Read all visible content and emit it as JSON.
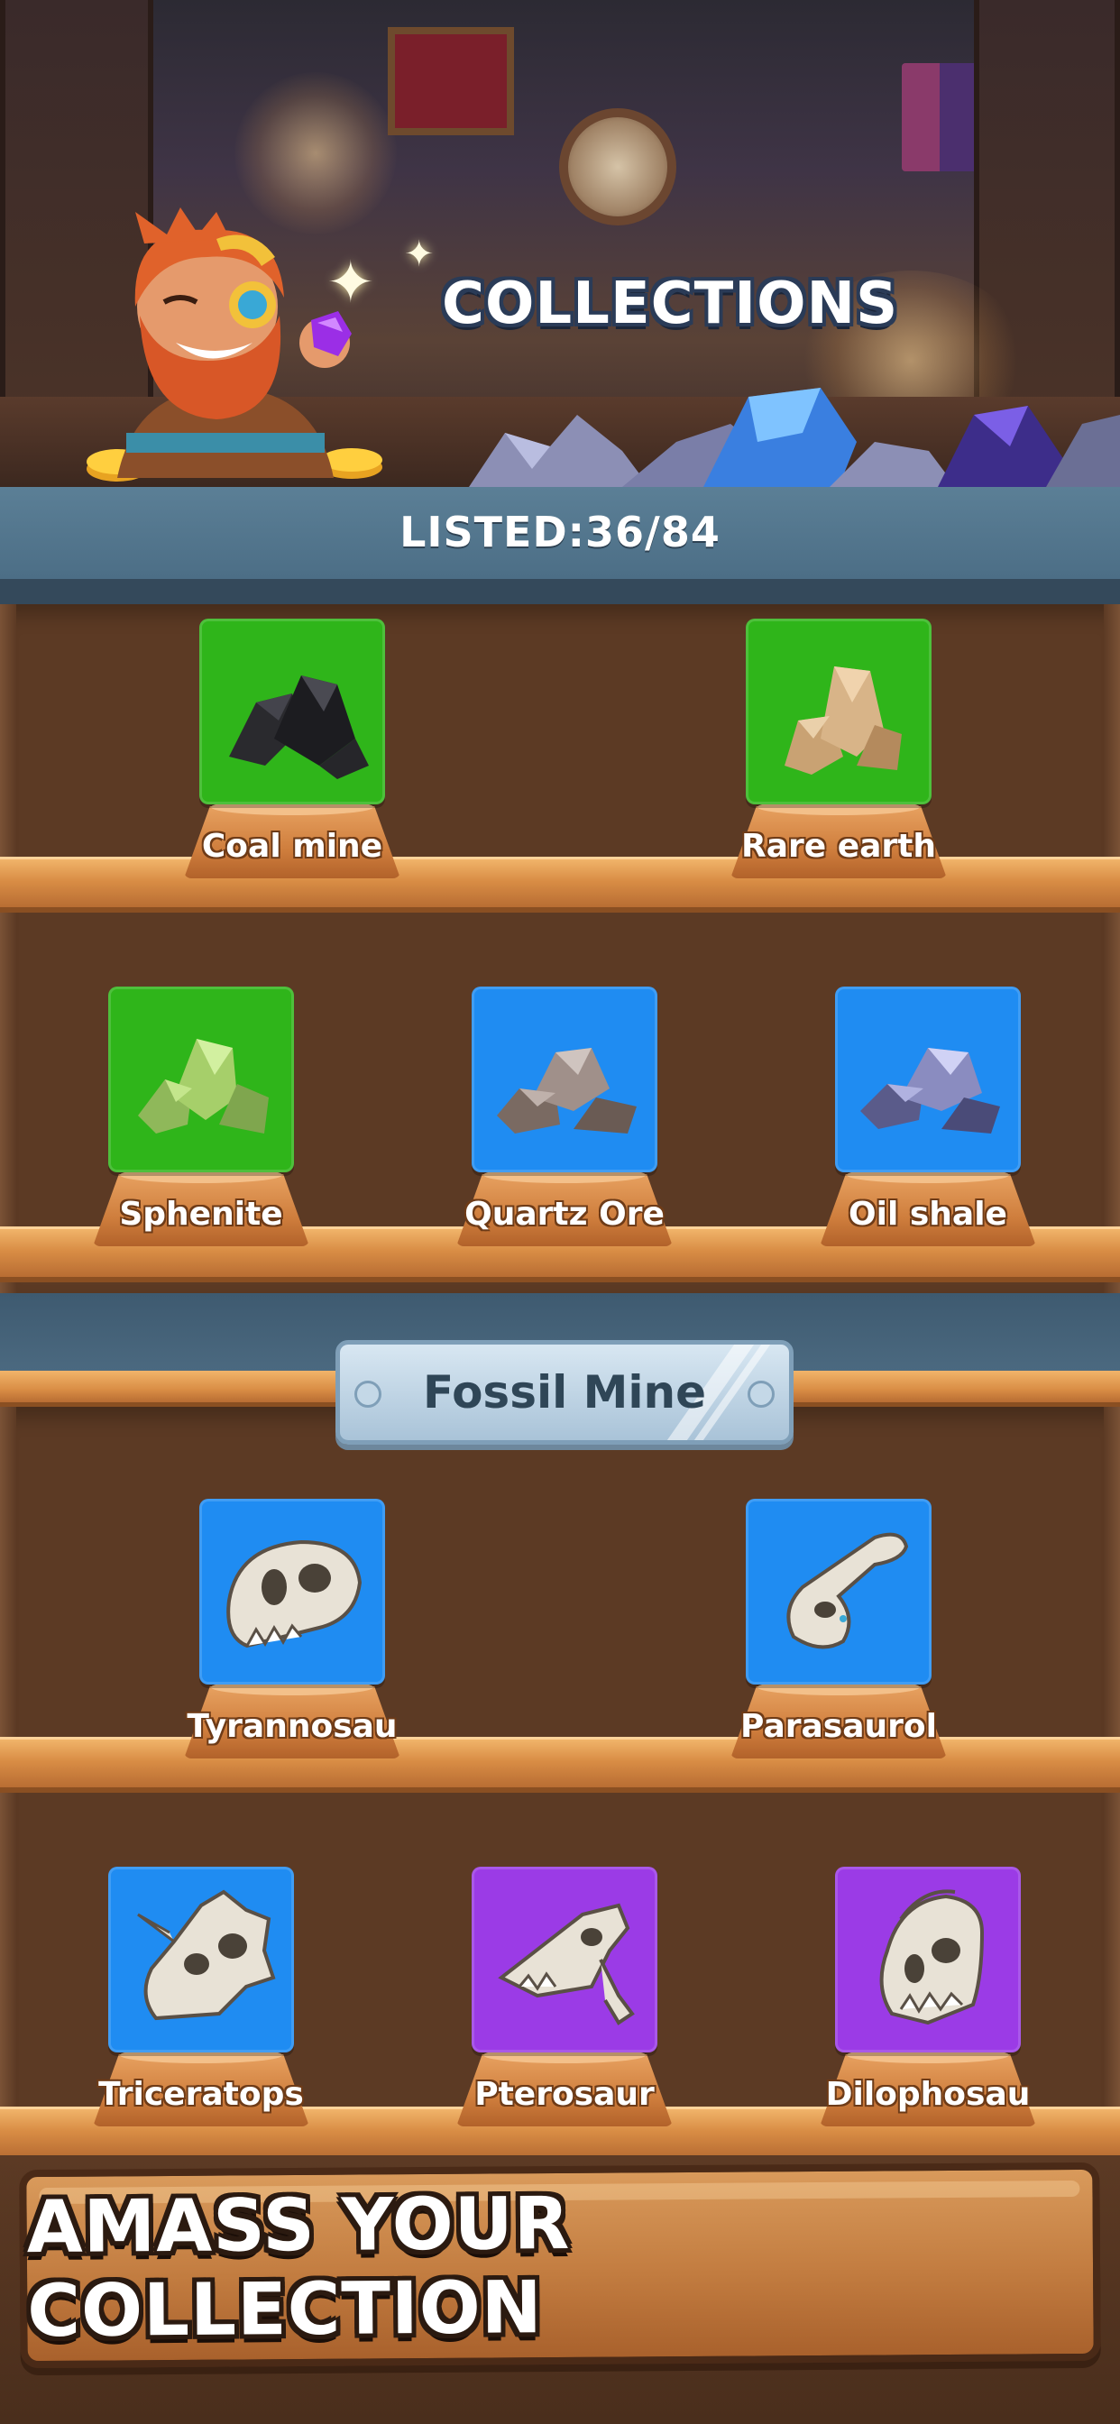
{
  "header": {
    "title": "COLLECTIONS"
  },
  "listed": {
    "label": "LISTED:36/84"
  },
  "shelves": [
    {
      "items": [
        {
          "name": "Coal mine",
          "color": "#2fb51a",
          "icon": "coal-icon"
        },
        {
          "name": "Rare earth",
          "color": "#2fb51a",
          "icon": "rare-earth-icon"
        }
      ]
    },
    {
      "items": [
        {
          "name": "Sphenite",
          "color": "#2fb51a",
          "icon": "sphenite-icon"
        },
        {
          "name": "Quartz Ore",
          "color": "#1f8cf2",
          "icon": "quartz-ore-icon"
        },
        {
          "name": "Oil shale",
          "color": "#1f8cf2",
          "icon": "oil-shale-icon"
        }
      ]
    }
  ],
  "fossil_section": {
    "label": "Fossil Mine",
    "shelves": [
      {
        "items": [
          {
            "name": "Tyrannosau",
            "color": "#1f8cf2",
            "icon": "t-rex-skull-icon"
          },
          {
            "name": "Parasaurol",
            "color": "#1f8cf2",
            "icon": "parasaurolophus-skull-icon"
          }
        ]
      },
      {
        "items": [
          {
            "name": "Triceratops",
            "color": "#1f8cf2",
            "icon": "triceratops-skull-icon"
          },
          {
            "name": "Pterosaur",
            "color": "#9b3be6",
            "icon": "pterosaur-skull-icon"
          },
          {
            "name": "Dilophosau",
            "color": "#9b3be6",
            "icon": "dilophosaurus-skull-icon"
          }
        ]
      }
    ]
  },
  "banner": {
    "text": "AMASS YOUR COLLECTION"
  }
}
